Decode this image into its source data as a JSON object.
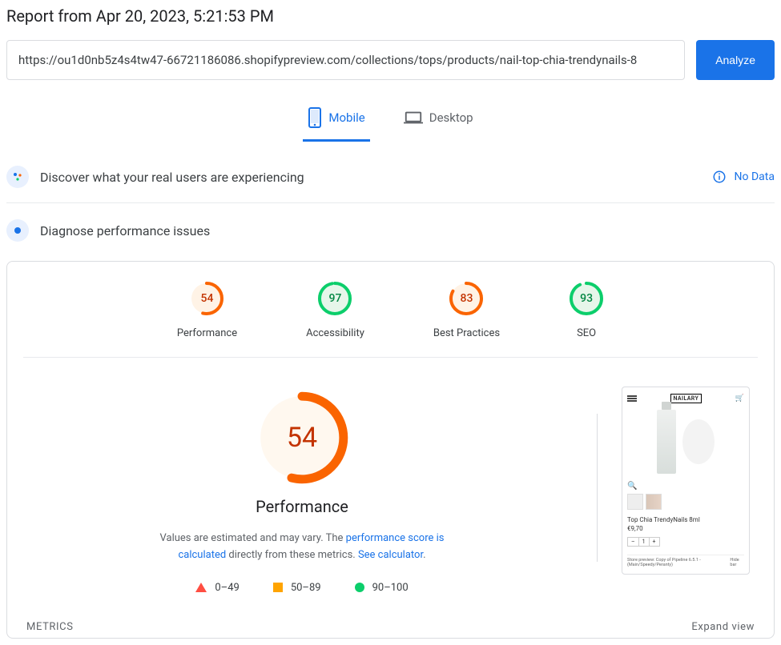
{
  "title": "Report from Apr 20, 2023, 5:21:53 PM",
  "url_value": "https://ou1d0nb5z4s4tw47-66721186086.shopifypreview.com/collections/tops/products/nail-top-chia-trendynails-8",
  "analyze_label": "Analyze",
  "tabs": {
    "mobile": "Mobile",
    "desktop": "Desktop"
  },
  "discover": {
    "title": "Discover what your real users are experiencing",
    "nodata": "No Data"
  },
  "diagnose": {
    "title": "Diagnose performance issues"
  },
  "gauges": [
    {
      "value": "54",
      "label": "Performance",
      "pct": 54,
      "cls": "orange"
    },
    {
      "value": "97",
      "label": "Accessibility",
      "pct": 97,
      "cls": "green"
    },
    {
      "value": "83",
      "label": "Best Practices",
      "pct": 83,
      "cls": "orange"
    },
    {
      "value": "93",
      "label": "SEO",
      "pct": 93,
      "cls": "green"
    }
  ],
  "big": {
    "value": "54",
    "pct": 54,
    "heading": "Performance"
  },
  "desc": {
    "pre": "Values are estimated and may vary. The ",
    "link1": "performance score is calculated",
    "mid": " directly from these metrics. ",
    "link2": "See calculator"
  },
  "legend": {
    "r": "0–49",
    "o": "50–89",
    "g": "90–100"
  },
  "preview": {
    "logo": "NAILARY",
    "name": "Top Chia TrendyNails 8ml",
    "price": "€9,70",
    "qty_minus": "–",
    "qty_val": "1",
    "qty_plus": "+",
    "foot_left": "Store preview: Copy of Pipeline 6.5.1 - (Main/Speedy/Peranty)",
    "foot_right": "Hide bar"
  },
  "metrics": {
    "label": "METRICS",
    "expand": "Expand view"
  }
}
